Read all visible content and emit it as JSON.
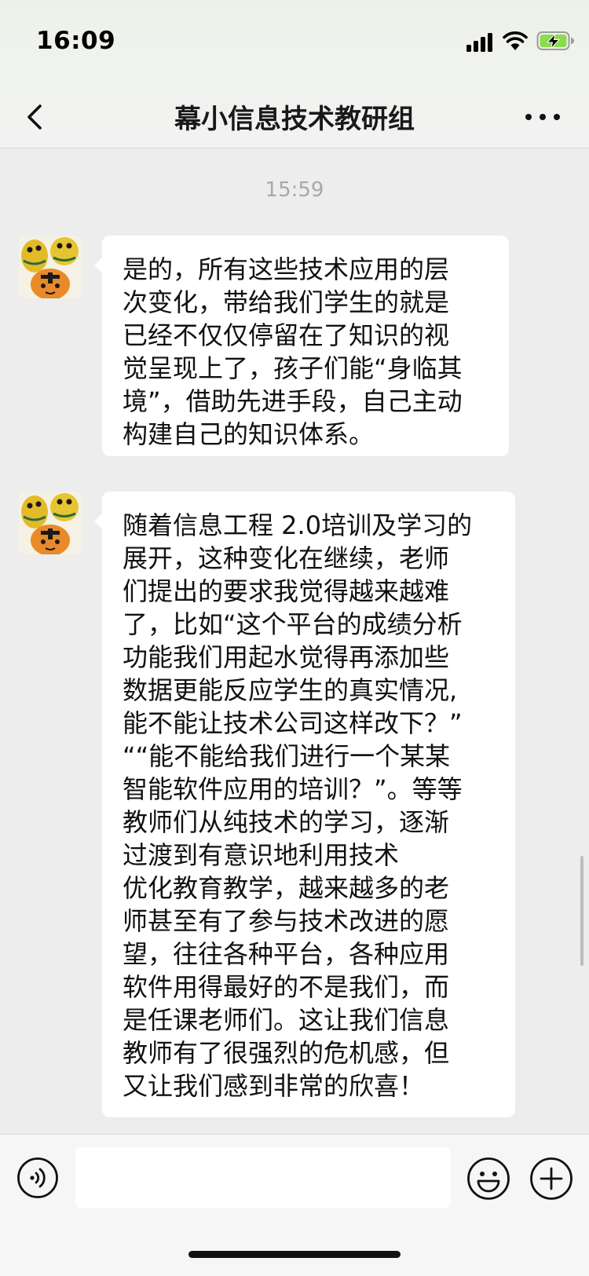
{
  "status_bar": {
    "time": "16:09"
  },
  "header": {
    "title": "幕小信息技术教研组"
  },
  "chat": {
    "timestamp": "15:59",
    "messages": [
      {
        "lines": [
          "是的，所有这些技术应用的层",
          "次变化，带给我们学生的就是",
          "已经不仅仅停留在了知识的视",
          "觉呈现上了，孩子们能“身临其",
          "境”，借助先进手段，自己主动",
          "构建自己的知识体系。"
        ]
      },
      {
        "lines": [
          "随着信息工程 2.0培训及学习的",
          "展开，这种变化在继续，老师",
          "们提出的要求我觉得越来越难",
          "了，比如“这个平台的成绩分析",
          "功能我们用起水觉得再添加些",
          "数据更能反应学生的真实情况,",
          "能不能让技术公司这样改下？”",
          "““能不能给我们进行一个某某",
          "智能软件应用的培训？”。等等",
          "教师们从纯技术的学习，逐渐",
          "过渡到有意识地利用技术",
          "优化教育教学，越来越多的老",
          "师甚至有了参与技术改进的愿",
          "望，往往各种平台，各种应用",
          "软件用得最好的不是我们，而",
          "是任课老师们。这让我们信息",
          "教师有了很强烈的危机感，但",
          "又让我们感到非常的欣喜！"
        ]
      }
    ]
  },
  "input_bar": {
    "placeholder": ""
  },
  "icons": {
    "back": "chevron-left-icon",
    "more": "more-dots-icon",
    "voice": "voice-icon",
    "emoji": "emoji-icon",
    "plus": "plus-icon"
  },
  "colors": {
    "background": "#ededed",
    "bubble": "#ffffff",
    "battery_charge": "#8bdb4e"
  }
}
